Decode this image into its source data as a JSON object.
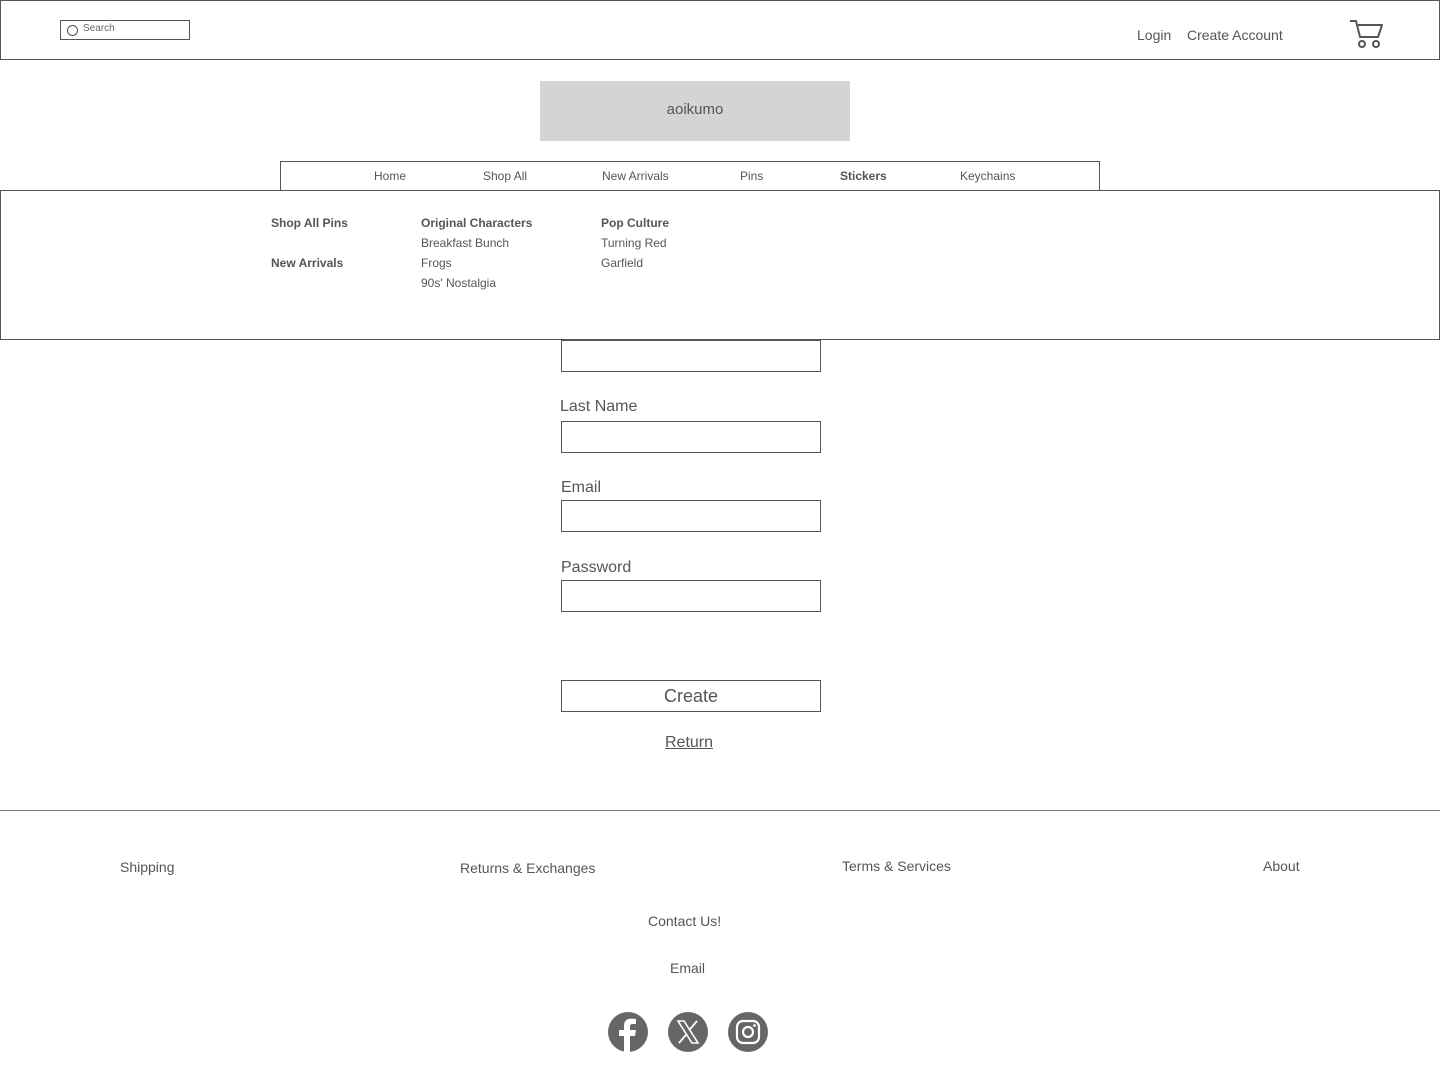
{
  "header": {
    "search_placeholder": "Search",
    "login_label": "Login",
    "create_account_label": "Create Account"
  },
  "logo": {
    "text": "aoikumo"
  },
  "nav": {
    "items": [
      {
        "label": "Home"
      },
      {
        "label": "Shop All"
      },
      {
        "label": "New Arrivals"
      },
      {
        "label": "Pins"
      },
      {
        "label": "Stickers",
        "active": true
      },
      {
        "label": "Keychains"
      }
    ]
  },
  "mega_menu": {
    "col1": {
      "heading1": "Shop All Pins",
      "heading2": "New Arrivals"
    },
    "col2": {
      "heading": "Original Characters",
      "items": [
        "Breakfast Bunch",
        "Frogs",
        "90s' Nostalgia"
      ]
    },
    "col3": {
      "heading": "Pop Culture",
      "items": [
        "Turning Red",
        "Garfield"
      ]
    }
  },
  "form": {
    "last_name_label": "Last Name",
    "email_label": "Email",
    "password_label": "Password",
    "create_button": "Create",
    "return_link": "Return"
  },
  "footer": {
    "shipping": "Shipping",
    "returns": "Returns & Exchanges",
    "terms": "Terms & Services",
    "about": "About",
    "contact": "Contact Us!",
    "email": "Email",
    "social_icons": [
      "facebook-icon",
      "x-icon",
      "instagram-icon"
    ]
  }
}
